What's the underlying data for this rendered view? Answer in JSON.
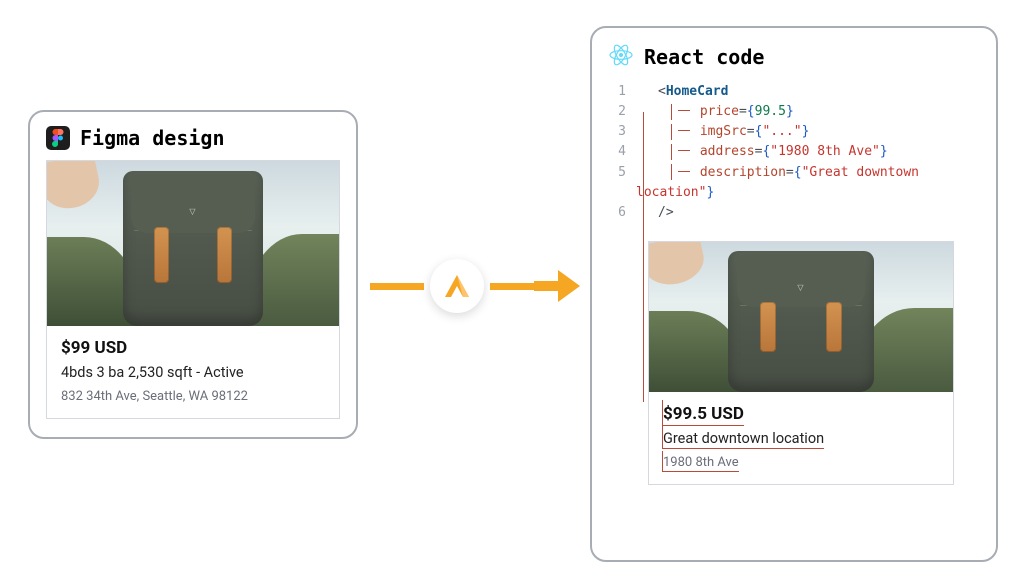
{
  "left": {
    "title": "Figma design",
    "card": {
      "price": "$99 USD",
      "desc": "4bds 3 ba 2,530 sqft - Active",
      "addr": "832 34th Ave, Seattle, WA 98122"
    }
  },
  "right": {
    "title": "React code",
    "code": {
      "component": "HomeCard",
      "lines": [
        "1",
        "2",
        "3",
        "4",
        "5",
        "6"
      ],
      "attrs": {
        "price_name": "price",
        "price_value": "99.5",
        "img_name": "imgSrc",
        "img_value": "\"...\"",
        "address_name": "address",
        "address_value": "\"1980 8th Ave\"",
        "description_name": "description",
        "description_value": "\"Great downtown location\""
      },
      "close": "/>"
    },
    "card": {
      "price": "$99.5 USD",
      "desc": "Great downtown location",
      "addr": "1980 8th Ave"
    }
  }
}
